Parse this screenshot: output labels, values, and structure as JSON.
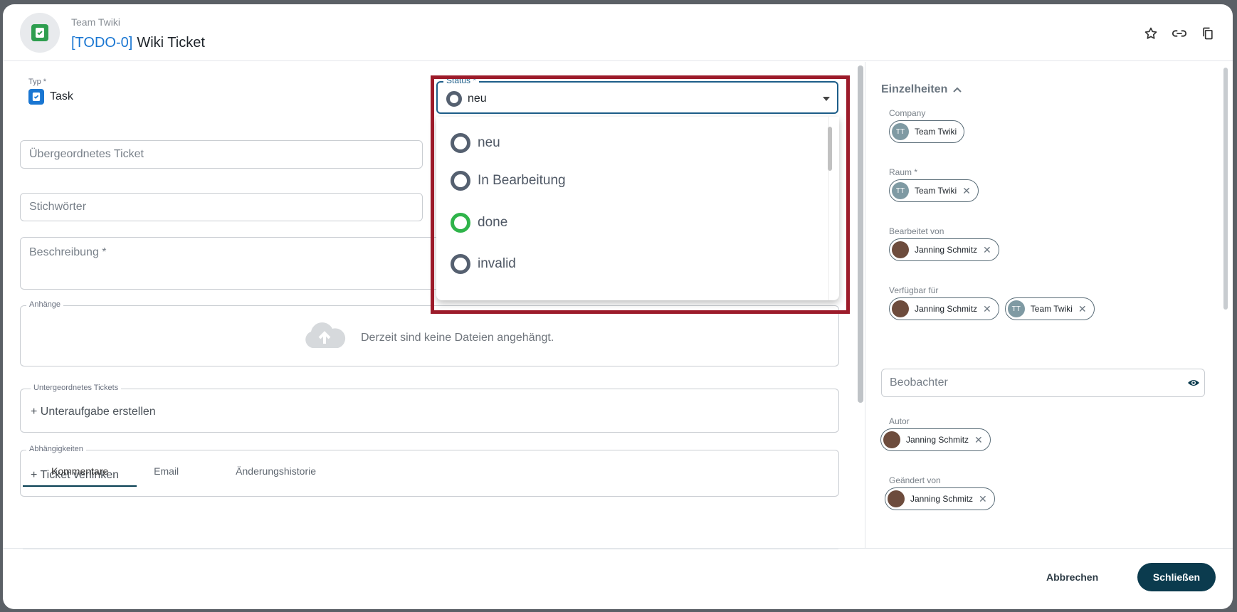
{
  "header": {
    "team": "Team Twiki",
    "ticket_key": "[TODO-0]",
    "ticket_title": "Wiki Ticket",
    "icons": [
      "star-icon",
      "link-icon",
      "copy-icon"
    ]
  },
  "form": {
    "typ_label": "Typ *",
    "typ_value": "Task",
    "parent_placeholder": "Übergeordnetes Ticket",
    "keywords_placeholder": "Stichwörter",
    "description_placeholder": "Beschreibung *",
    "attachments_legend": "Anhänge",
    "attachments_empty": "Derzeit sind keine Dateien angehängt.",
    "subtickets_legend": "Untergeordnetes Tickets",
    "subtickets_action": "+ Unteraufgabe erstellen",
    "dependencies_legend": "Abhängigkeiten",
    "dependencies_action": "+ Ticket verlinken"
  },
  "status": {
    "label": "Status *",
    "value": "neu",
    "options": [
      {
        "label": "neu",
        "color": "#556070"
      },
      {
        "label": "In Bearbeitung",
        "color": "#556070"
      },
      {
        "label": "done",
        "color": "#2fb44a"
      },
      {
        "label": "invalid",
        "color": "#556070"
      }
    ]
  },
  "tabs": [
    "Kommentare",
    "Email",
    "Änderungshistorie"
  ],
  "details": {
    "heading": "Einzelheiten",
    "company_label": "Company",
    "company_chip": {
      "initials": "TT",
      "name": "Team Twiki"
    },
    "raum_label": "Raum *",
    "raum_chip": {
      "initials": "TT",
      "name": "Team Twiki"
    },
    "bearbeitet_label": "Bearbeitet von",
    "bearbeitet_chip": "Janning Schmitz",
    "verfuegbar_label": "Verfügbar für",
    "verfuegbar_chips": [
      "Janning Schmitz",
      "Team Twiki"
    ],
    "verfuegbar_team_initials": "TT",
    "beobachter_placeholder": "Beobachter",
    "autor_label": "Autor",
    "autor_chip": "Janning Schmitz",
    "geaendert_label": "Geändert von",
    "geaendert_chip": "Janning Schmitz"
  },
  "footer": {
    "cancel": "Abbrechen",
    "close": "Schließen"
  },
  "colors": {
    "primary": "#0b3b4e",
    "link": "#1976d2",
    "highlight": "#9c1b2a",
    "done": "#2fb44a"
  }
}
